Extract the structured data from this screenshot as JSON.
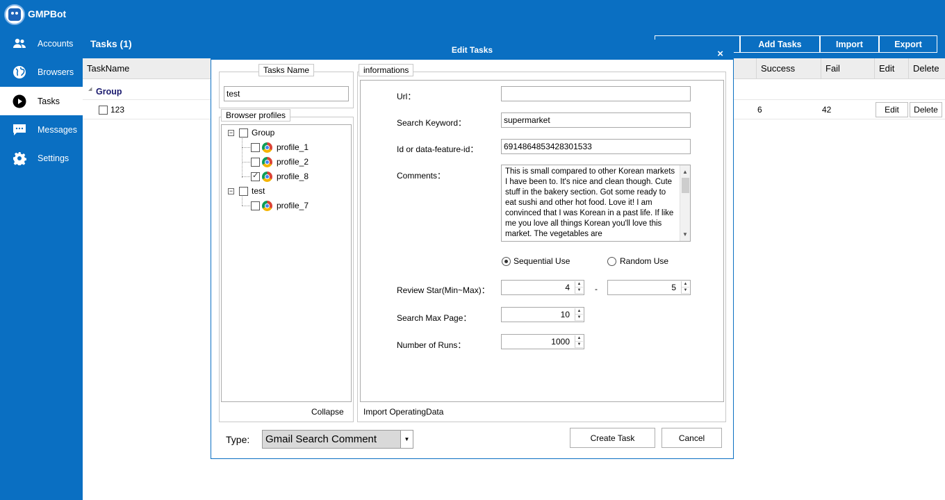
{
  "app": {
    "title": "GMPBot"
  },
  "sidebar": {
    "items": [
      {
        "label": "Accounts",
        "icon": "users-icon"
      },
      {
        "label": "Browsers",
        "icon": "globe-icon"
      },
      {
        "label": "Tasks",
        "icon": "play-icon",
        "active": true
      },
      {
        "label": "Messages",
        "icon": "chat-icon"
      },
      {
        "label": "Settings",
        "icon": "gear-icon"
      }
    ]
  },
  "main": {
    "title": "Tasks (1)",
    "buttons": {
      "add": "Add Tasks",
      "import": "Import",
      "export": "Export"
    },
    "columns": {
      "taskname": "TaskName",
      "success": "Success",
      "fail": "Fail",
      "edit": "Edit",
      "delete": "Delete"
    },
    "group": "Group",
    "rows": [
      {
        "name": "123",
        "success": "6",
        "fail": "42",
        "edit": "Edit",
        "delete": "Delete"
      }
    ]
  },
  "dialog": {
    "title": "Edit Tasks",
    "close": "×",
    "tasks_name_legend": "Tasks Name",
    "tasks_name_value": "test",
    "profiles_legend": "Browser profiles",
    "tree": {
      "group1": "Group",
      "profiles1": [
        {
          "name": "profile_1",
          "checked": false
        },
        {
          "name": "profile_2",
          "checked": false
        },
        {
          "name": "profile_8",
          "checked": true
        }
      ],
      "group2": "test",
      "profiles2": [
        {
          "name": "profile_7",
          "checked": false
        }
      ]
    },
    "collapse": "Collapse",
    "info_legend": "informations",
    "url_label": "Url：",
    "url_value": "",
    "keyword_label": "Search  Keyword：",
    "keyword_value": "supermarket",
    "id_label": "Id  or  data-feature-id：",
    "id_value": "6914864853428301533",
    "comments_label": "Comments：",
    "comments_value": "This is small compared to other Korean markets I have been to. It's nice and clean though. Cute stuff in the bakery section. Got some ready to eat sushi and other hot food. Love it! I am convinced that I was Korean in a past life. If like me you love all things Korean you'll love this market. The vegetables are",
    "sequential": "Sequential Use",
    "random": "Random Use",
    "review_label": "Review  Star(Min~Max)：",
    "review_min": "4",
    "review_dash": "-",
    "review_max": "5",
    "max_page_label": "Search Max Page：",
    "max_page": "10",
    "runs_label": "Number of Runs：",
    "runs": "1000",
    "import_label": "Import OperatingData",
    "type_label": "Type:",
    "type_value": "Gmail Search Comment",
    "create": "Create Task",
    "cancel": "Cancel"
  }
}
